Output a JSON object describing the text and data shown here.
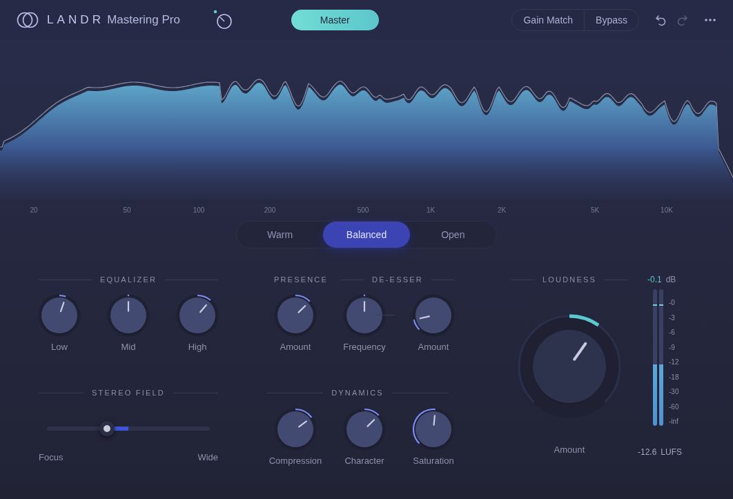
{
  "header": {
    "logo": "LANDR",
    "product": "Mastering Pro",
    "master_button": "Master",
    "toggles": [
      {
        "label": "Gain Match",
        "on": false
      },
      {
        "label": "Bypass",
        "on": false
      }
    ],
    "history": [
      {
        "kind": "undo",
        "disabled": false
      },
      {
        "kind": "redo",
        "disabled": true
      }
    ]
  },
  "spectrum": {
    "frequency_labels": [
      "20",
      "50",
      "100",
      "200",
      "500",
      "1K",
      "2K",
      "5K",
      "10K"
    ]
  },
  "styles": [
    {
      "label": "Warm",
      "selected": false
    },
    {
      "label": "Balanced",
      "selected": true
    },
    {
      "label": "Open",
      "selected": false
    }
  ],
  "equalizer": {
    "title": "EQUALIZER",
    "knobs": [
      {
        "label": "Low",
        "level": 0.57,
        "kind": "bipolar"
      },
      {
        "label": "Mid",
        "level": 0.5,
        "kind": "bipolar"
      },
      {
        "label": "High",
        "level": 0.65,
        "kind": "bipolar"
      }
    ]
  },
  "presence": {
    "title": "PRESENCE",
    "knobs": [
      {
        "label": "Amount",
        "level": 0.67,
        "kind": "bipolar"
      }
    ]
  },
  "de_esser": {
    "title": "DE-ESSER",
    "knobs": [
      {
        "label": "Frequency",
        "level": 0.5,
        "kind": "bipolar"
      },
      {
        "label": "Amount",
        "level": 0.12,
        "kind": "unipolar"
      }
    ]
  },
  "stereo_field": {
    "title": "STEREO FIELD",
    "level": 0.37,
    "left_label": "Focus",
    "right_label": "Wide"
  },
  "dynamics": {
    "title": "DYNAMICS",
    "knobs": [
      {
        "label": "Compression",
        "level": 0.7,
        "kind": "bipolar"
      },
      {
        "label": "Character",
        "level": 0.67,
        "kind": "bipolar"
      },
      {
        "label": "Saturation",
        "level": 0.52,
        "kind": "unipolar"
      }
    ]
  },
  "loudness": {
    "title": "LOUDNESS",
    "knob": {
      "label": "Amount",
      "level": 0.63,
      "kind": "bipolar"
    },
    "peak_reading": "-0.1",
    "peak_unit": "dB",
    "meter": {
      "channels": [
        {
          "level": 0.45
        },
        {
          "level": 0.45
        }
      ],
      "scale": [
        "-0",
        "-3",
        "-6",
        "-9",
        "-12",
        "-18",
        "-30",
        "-60",
        "-inf"
      ]
    },
    "lufs_reading": "-12.6",
    "lufs_unit": "LUFS"
  }
}
